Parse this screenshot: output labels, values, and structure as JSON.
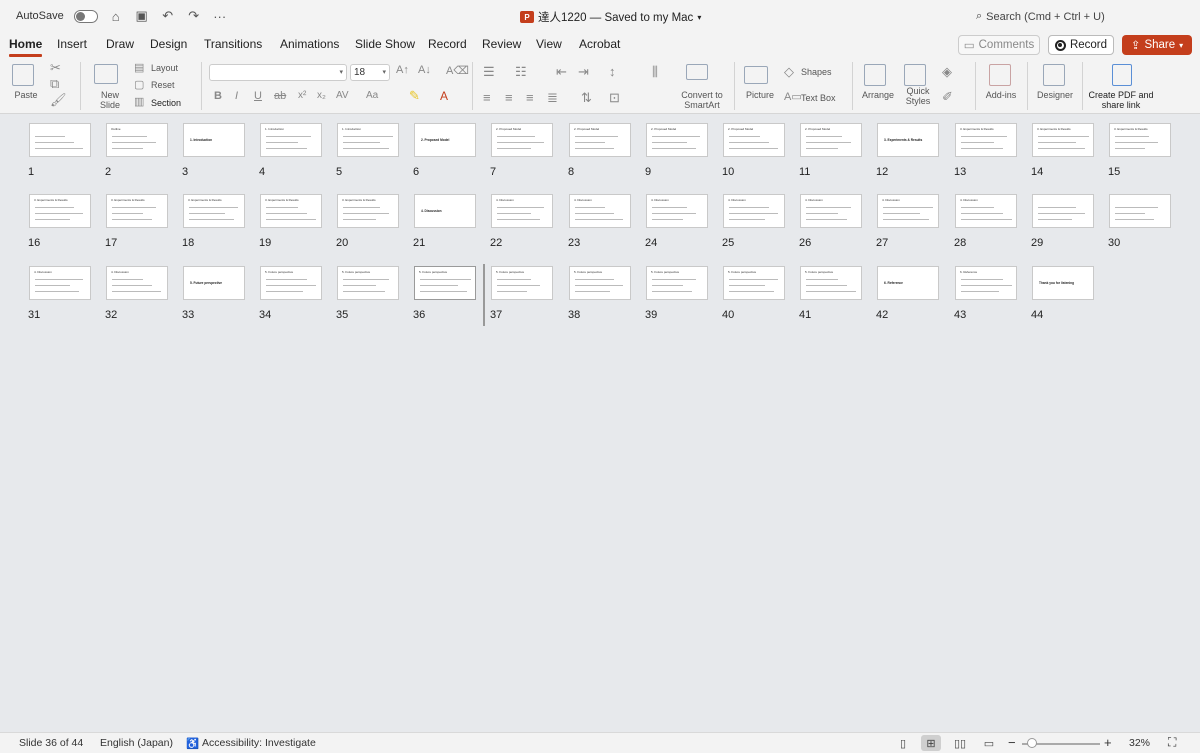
{
  "titlebar": {
    "autosave_label": "AutoSave",
    "doc_title": "達人1220 — Saved to my Mac",
    "search_label": "Search (Cmd + Ctrl + U)"
  },
  "tabs": [
    "Home",
    "Insert",
    "Draw",
    "Design",
    "Transitions",
    "Animations",
    "Slide Show",
    "Record",
    "Review",
    "View",
    "Acrobat"
  ],
  "actions": {
    "comments": "Comments",
    "record": "Record",
    "share": "Share"
  },
  "ribbon": {
    "paste": "Paste",
    "new_slide": "New Slide",
    "layout": "Layout",
    "reset": "Reset",
    "section": "Section",
    "font_size": "18",
    "convert_smartart": "Convert to SmartArt",
    "picture": "Picture",
    "shapes": "Shapes",
    "text_box": "Text Box",
    "arrange": "Arrange",
    "quick_styles": "Quick Styles",
    "add_ins": "Add-ins",
    "designer": "Designer",
    "create_pdf": "Create PDF and share link"
  },
  "slides": [
    {
      "n": "1",
      "t": ""
    },
    {
      "n": "2",
      "t": "Outline"
    },
    {
      "n": "3",
      "t": "1. Introduction"
    },
    {
      "n": "4",
      "t": "1. Introduction"
    },
    {
      "n": "5",
      "t": "1. Introduction"
    },
    {
      "n": "6",
      "t": "2. Proposed Model"
    },
    {
      "n": "7",
      "t": "2. Proposed Model"
    },
    {
      "n": "8",
      "t": "2. Proposed Model"
    },
    {
      "n": "9",
      "t": "2. Proposed Model"
    },
    {
      "n": "10",
      "t": "2. Proposed Model"
    },
    {
      "n": "11",
      "t": "2. Proposed Model"
    },
    {
      "n": "12",
      "t": "3. Experiments & Results"
    },
    {
      "n": "13",
      "t": "3. Experiments & Results"
    },
    {
      "n": "14",
      "t": "3. Experiments & Results"
    },
    {
      "n": "15",
      "t": "3. Experiments & Results"
    },
    {
      "n": "16",
      "t": "3. Experiments & Results"
    },
    {
      "n": "17",
      "t": "3. Experiments & Results"
    },
    {
      "n": "18",
      "t": "3. Experiments & Results"
    },
    {
      "n": "19",
      "t": "3. Experiments & Results"
    },
    {
      "n": "20",
      "t": "3. Experiments & Results"
    },
    {
      "n": "21",
      "t": "4. Discussion"
    },
    {
      "n": "22",
      "t": "4. Discussion"
    },
    {
      "n": "23",
      "t": "4. Discussion"
    },
    {
      "n": "24",
      "t": "4. Discussion"
    },
    {
      "n": "25",
      "t": "4. Discussion"
    },
    {
      "n": "26",
      "t": "4. Discussion"
    },
    {
      "n": "27",
      "t": "4. Discussion"
    },
    {
      "n": "28",
      "t": "4. Discussion"
    },
    {
      "n": "29",
      "t": ""
    },
    {
      "n": "30",
      "t": ""
    },
    {
      "n": "31",
      "t": "4. Discussion"
    },
    {
      "n": "32",
      "t": "4. Discussion"
    },
    {
      "n": "33",
      "t": "5. Future perspective"
    },
    {
      "n": "34",
      "t": "5. Future perspective"
    },
    {
      "n": "35",
      "t": "5. Future perspective"
    },
    {
      "n": "36",
      "t": "5. Future perspective"
    },
    {
      "n": "37",
      "t": "5. Future perspective"
    },
    {
      "n": "38",
      "t": "5. Future perspective"
    },
    {
      "n": "39",
      "t": "5. Future perspective"
    },
    {
      "n": "40",
      "t": "5. Future perspective"
    },
    {
      "n": "41",
      "t": "5. Future perspective"
    },
    {
      "n": "42",
      "t": "6. Reference"
    },
    {
      "n": "43",
      "t": "6. Reference"
    },
    {
      "n": "44",
      "t": "Thank you for listening"
    }
  ],
  "status": {
    "slide_pos": "Slide 36 of 44",
    "language": "English (Japan)",
    "accessibility": "Accessibility: Investigate",
    "zoom": "32%"
  }
}
